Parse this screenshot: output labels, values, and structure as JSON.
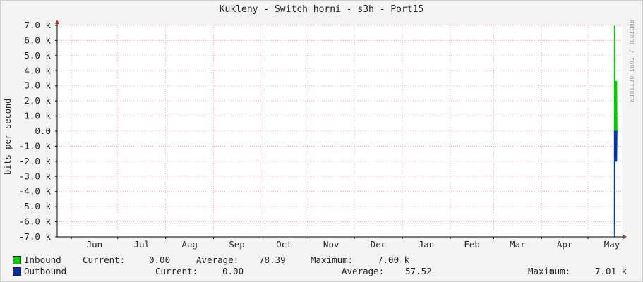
{
  "title": "Kukleny - Switch horni - s3h - Port15",
  "watermark": "RRDTOOL / TOBI OETIKER",
  "colors": {
    "inbound": "#00cc00",
    "outbound": "#0033aa",
    "grid": "#e8a8a8",
    "axis": "#000000",
    "arrow": "#aa3333",
    "canvas": "#ffffff",
    "background": "#f3f3f3"
  },
  "legend": {
    "inbound": {
      "name": "Inbound",
      "current_label": "Current:",
      "current_value": "0.00",
      "average_label": "Average:",
      "average_value": "78.39",
      "maximum_label": "Maximum:",
      "maximum_value": "7.00 k"
    },
    "outbound": {
      "name": "Outbound",
      "current_label": "Current:",
      "current_value": "0.00",
      "average_label": "Average:",
      "average_value": "57.52",
      "maximum_label": "Maximum:",
      "maximum_value": "7.01 k"
    }
  },
  "chart_data": {
    "type": "area",
    "title": "Kukleny - Switch horni - s3h - Port15",
    "xlabel": "",
    "ylabel": "bits per second",
    "ylim": [
      -7000,
      7000
    ],
    "yticks": [
      {
        "value": 7000,
        "label": "7.0 k"
      },
      {
        "value": 6000,
        "label": "6.0 k"
      },
      {
        "value": 5000,
        "label": "5.0 k"
      },
      {
        "value": 4000,
        "label": "4.0 k"
      },
      {
        "value": 3000,
        "label": "3.0 k"
      },
      {
        "value": 2000,
        "label": "2.0 k"
      },
      {
        "value": 1000,
        "label": "1.0 k"
      },
      {
        "value": 0,
        "label": "0.0"
      },
      {
        "value": -1000,
        "label": "-1.0 k"
      },
      {
        "value": -2000,
        "label": "-2.0 k"
      },
      {
        "value": -3000,
        "label": "-3.0 k"
      },
      {
        "value": -4000,
        "label": "-4.0 k"
      },
      {
        "value": -5000,
        "label": "-5.0 k"
      },
      {
        "value": -6000,
        "label": "-6.0 k"
      },
      {
        "value": -7000,
        "label": "-7.0 k"
      }
    ],
    "x_range_days": [
      0,
      365
    ],
    "month_ticks": [
      {
        "label": "Jun",
        "start_day": 0,
        "mid_day": 15
      },
      {
        "label": "Jul",
        "start_day": 30,
        "mid_day": 45.5
      },
      {
        "label": "Aug",
        "start_day": 61,
        "mid_day": 76.5
      },
      {
        "label": "Sep",
        "start_day": 92,
        "mid_day": 107
      },
      {
        "label": "Oct",
        "start_day": 122,
        "mid_day": 137.5
      },
      {
        "label": "Nov",
        "start_day": 153,
        "mid_day": 168
      },
      {
        "label": "Dec",
        "start_day": 183,
        "mid_day": 198.5
      },
      {
        "label": "Jan",
        "start_day": 214,
        "mid_day": 229.5
      },
      {
        "label": "Feb",
        "start_day": 245,
        "mid_day": 259
      },
      {
        "label": "Mar",
        "start_day": 273,
        "mid_day": 288.5
      },
      {
        "label": "Apr",
        "start_day": 304,
        "mid_day": 319
      },
      {
        "label": "May",
        "start_day": 334,
        "mid_day": 349.5
      }
    ],
    "series": [
      {
        "name": "Inbound",
        "direction": "up",
        "points": [
          {
            "x_day": 351.0,
            "y": 7000
          },
          {
            "x_day": 351.4,
            "y": 3300
          },
          {
            "x_day": 352.6,
            "y": 3300
          },
          {
            "x_day": 352.8,
            "y": 0
          }
        ]
      },
      {
        "name": "Outbound",
        "direction": "down",
        "points": [
          {
            "x_day": 351.0,
            "y": -7000
          },
          {
            "x_day": 351.4,
            "y": -2000
          },
          {
            "x_day": 352.6,
            "y": -2000
          },
          {
            "x_day": 352.8,
            "y": 0
          }
        ]
      }
    ],
    "grid": true,
    "legend_position": "bottom"
  }
}
